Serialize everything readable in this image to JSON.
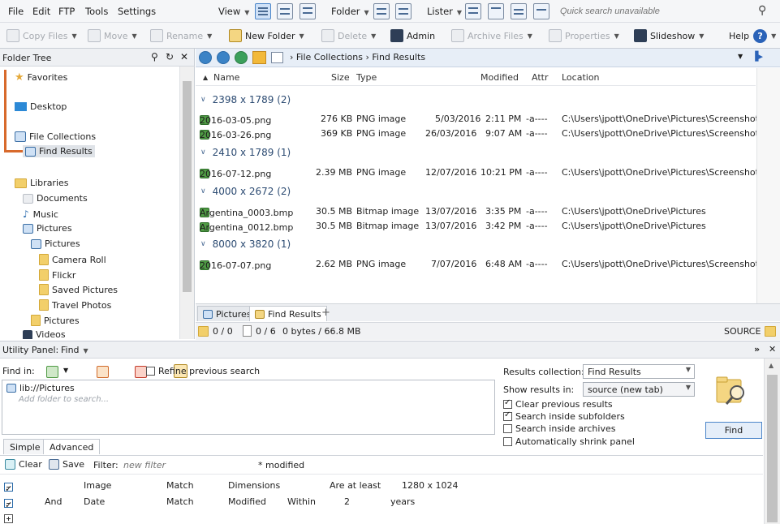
{
  "menu": [
    "File",
    "Edit",
    "FTP",
    "Tools",
    "Settings"
  ],
  "view": {
    "view_label": "View",
    "folder_label": "Folder",
    "lister_label": "Lister",
    "quick_search_placeholder": "Quick search unavailable"
  },
  "toolbar": {
    "copy_files": "Copy Files",
    "move": "Move",
    "rename": "Rename",
    "new_folder": "New Folder",
    "delete": "Delete",
    "admin": "Admin",
    "archive_files": "Archive Files",
    "properties": "Properties",
    "slideshow": "Slideshow",
    "help": "Help"
  },
  "folder_tree": {
    "title": "Folder Tree",
    "items": [
      "Favorites",
      "Desktop",
      "File Collections",
      "Find Results",
      "Libraries",
      "Documents",
      "Music",
      "Pictures",
      "Pictures",
      "Camera Roll",
      "Flickr",
      "Saved Pictures",
      "Travel Photos",
      "Pictures",
      "Videos"
    ]
  },
  "path": {
    "segments": [
      "File Collections",
      "Find Results"
    ]
  },
  "columns": {
    "name": "Name",
    "size": "Size",
    "type": "Type",
    "modified": "Modified",
    "attr": "Attr",
    "location": "Location"
  },
  "groups": [
    {
      "label": "2398 x 1789 (2)",
      "files": [
        {
          "name": "2016-03-05.png",
          "size": "276 KB",
          "type": "PNG image",
          "date": "5/03/2016",
          "time": "2:11 PM",
          "attr": "-a----",
          "location": "C:\\Users\\jpott\\OneDrive\\Pictures\\Screenshots"
        },
        {
          "name": "2016-03-26.png",
          "size": "369 KB",
          "type": "PNG image",
          "date": "26/03/2016",
          "time": "9:07 AM",
          "attr": "-a----",
          "location": "C:\\Users\\jpott\\OneDrive\\Pictures\\Screenshots"
        }
      ]
    },
    {
      "label": "2410 x 1789 (1)",
      "files": [
        {
          "name": "2016-07-12.png",
          "size": "2.39 MB",
          "type": "PNG image",
          "date": "12/07/2016",
          "time": "10:21 PM",
          "attr": "-a----",
          "location": "C:\\Users\\jpott\\OneDrive\\Pictures\\Screenshots"
        }
      ]
    },
    {
      "label": "4000 x 2672 (2)",
      "files": [
        {
          "name": "Argentina_0003.bmp",
          "size": "30.5 MB",
          "type": "Bitmap image",
          "date": "13/07/2016",
          "time": "3:35 PM",
          "attr": "-a----",
          "location": "C:\\Users\\jpott\\OneDrive\\Pictures"
        },
        {
          "name": "Argentina_0012.bmp",
          "size": "30.5 MB",
          "type": "Bitmap image",
          "date": "13/07/2016",
          "time": "3:42 PM",
          "attr": "-a----",
          "location": "C:\\Users\\jpott\\OneDrive\\Pictures"
        }
      ]
    },
    {
      "label": "8000 x 3820 (1)",
      "files": [
        {
          "name": "2016-07-07.png",
          "size": "2.62 MB",
          "type": "PNG image",
          "date": "7/07/2016",
          "time": "6:48 AM",
          "attr": "-a----",
          "location": "C:\\Users\\jpott\\OneDrive\\Pictures\\Screenshots"
        }
      ]
    }
  ],
  "tabs": [
    "Pictures",
    "Find Results"
  ],
  "status": {
    "folders": "0 / 0",
    "files": "0 / 6",
    "bytes": "0 bytes / 66.8 MB",
    "source": "SOURCE"
  },
  "utility": {
    "title": "Utility Panel:",
    "mode": "Find",
    "find_in_label": "Find in:",
    "refine_label": "Refine previous search",
    "folder_item": "lib://Pictures",
    "add_folder": "Add folder to search...",
    "results_collection_label": "Results collection:",
    "results_collection_value": "Find Results",
    "show_results_label": "Show results in:",
    "show_results_value": "source (new tab)",
    "options": [
      {
        "label": "Clear previous results",
        "checked": true
      },
      {
        "label": "Search inside subfolders",
        "checked": true
      },
      {
        "label": "Search inside archives",
        "checked": false
      },
      {
        "label": "Automatically shrink panel",
        "checked": false
      }
    ],
    "find_button": "Find",
    "subtabs": [
      "Simple",
      "Advanced"
    ],
    "clear_label": "Clear",
    "save_label": "Save",
    "filter_label": "Filter:",
    "filter_placeholder": "new filter",
    "modified_label": "* modified",
    "rules": [
      {
        "conj": "",
        "field": "Image",
        "op": "Match",
        "prop": "Dimensions",
        "cmp": "Are at least",
        "value": "1280 x 1024",
        "unit": ""
      },
      {
        "conj": "And",
        "field": "Date",
        "op": "Match",
        "prop": "Modified",
        "cmp": "Within",
        "value": "2",
        "unit": "years"
      }
    ]
  }
}
